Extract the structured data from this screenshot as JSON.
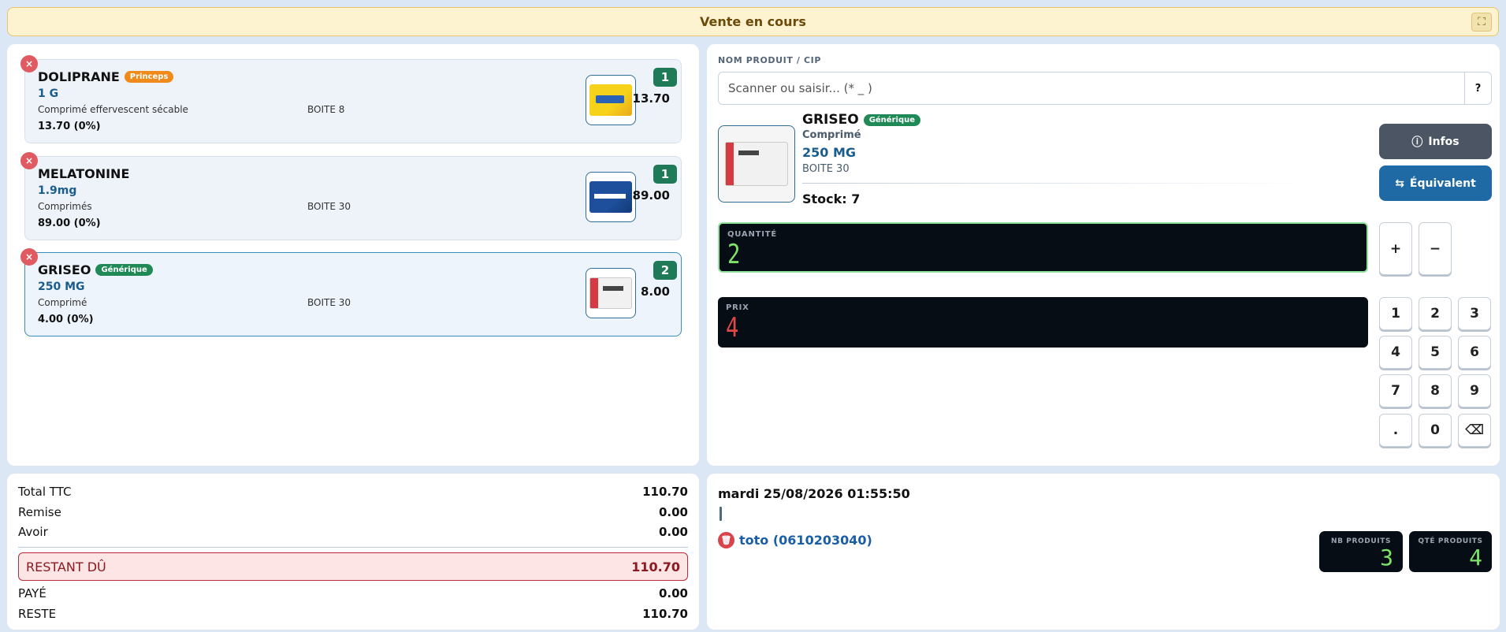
{
  "header": {
    "title": "Vente en cours",
    "expand_icon": "⛶"
  },
  "cart": {
    "items": [
      {
        "name": "DOLIPRANE",
        "badge": "Princeps",
        "dose": "1 G",
        "form": "Comprimé effervescent sécable",
        "pack": "BOITE 8",
        "unit_price": "13.70 (0%)",
        "qty": "1",
        "line_total": "13.70"
      },
      {
        "name": "MELATONINE",
        "badge": "",
        "dose": "1.9mg",
        "form": "Comprimés",
        "pack": "BOITE 30",
        "unit_price": "89.00 (0%)",
        "qty": "1",
        "line_total": "89.00"
      },
      {
        "name": "GRISEO",
        "badge": "Générique",
        "dose": "250 MG",
        "form": "Comprimé",
        "pack": "BOITE 30",
        "unit_price": "4.00 (0%)",
        "qty": "2",
        "line_total": "8.00"
      }
    ],
    "remove_icon": "×"
  },
  "search": {
    "label": "NOM PRODUIT / CIP",
    "placeholder": "Scanner ou saisir... (* _ )",
    "value": "",
    "help_label": "?"
  },
  "product": {
    "name": "GRISEO",
    "badge": "Générique",
    "form": "Comprimé",
    "dose": "250 MG",
    "pack": "BOITE 30",
    "stock": "Stock: 7"
  },
  "actions": {
    "infos_label": "Infos",
    "infos_icon": "ⓘ",
    "equivalent_label": "Équivalent",
    "equivalent_icon": "⇆"
  },
  "quantity": {
    "label": "QUANTITÉ",
    "value": "2"
  },
  "price": {
    "label": "PRIX",
    "value": "4"
  },
  "keypad": {
    "plus": "+",
    "minus": "−",
    "k1": "1",
    "k2": "2",
    "k3": "3",
    "k4": "4",
    "k5": "5",
    "k6": "6",
    "k7": "7",
    "k8": "8",
    "k9": "9",
    "dot": ".",
    "k0": "0",
    "back": "⌫"
  },
  "totals": {
    "total_ttc_label": "Total TTC",
    "total_ttc": "110.70",
    "remise_label": "Remise",
    "remise": "0.00",
    "avoir_label": "Avoir",
    "avoir": "0.00",
    "restant_label": "RESTANT DÛ",
    "restant": "110.70",
    "paye_label": "PAYÉ",
    "paye": "0.00",
    "reste_label": "RESTE",
    "reste": "110.70"
  },
  "sale": {
    "datetime": "mardi 25/08/2026 01:55:50",
    "client": "toto (0610203040)",
    "trash_icon": "🗑",
    "nb_produits_label": "NB PRODUITS",
    "nb_produits": "3",
    "qte_produits_label": "QTÉ PRODUITS",
    "qte_produits": "4"
  },
  "colors": {
    "accent": "#1f6aa5",
    "badge_princeps": "#f08a1a",
    "badge_generique": "#1f8a55",
    "due_red": "#b92e36",
    "lcd_green": "#7ee36a",
    "lcd_red": "#e04848"
  }
}
